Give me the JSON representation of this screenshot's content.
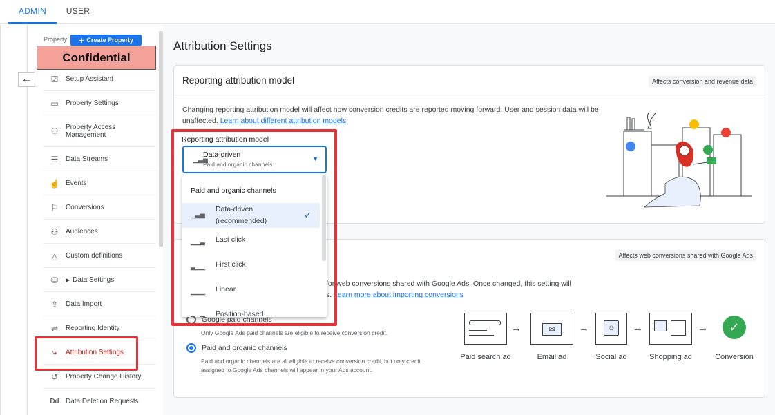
{
  "tabs": {
    "admin": "ADMIN",
    "user": "USER"
  },
  "sidebar": {
    "property_label": "Property",
    "create_button": "Create Property",
    "confidential": "Confidential",
    "items": [
      {
        "label": "Setup Assistant",
        "icon": "checkbox-icon"
      },
      {
        "label": "Property Settings",
        "icon": "window-icon"
      },
      {
        "label": "Property Access Management",
        "icon": "people-icon"
      },
      {
        "label": "Data Streams",
        "icon": "streams-icon"
      },
      {
        "label": "Events",
        "icon": "touch-icon"
      },
      {
        "label": "Conversions",
        "icon": "flag-icon"
      },
      {
        "label": "Audiences",
        "icon": "audience-icon"
      },
      {
        "label": "Custom definitions",
        "icon": "shapes-icon"
      },
      {
        "label": "Data Settings",
        "icon": "database-icon"
      },
      {
        "label": "Data Import",
        "icon": "upload-icon"
      },
      {
        "label": "Reporting Identity",
        "icon": "identity-icon"
      },
      {
        "label": "Attribution Settings",
        "icon": "attribution-icon"
      },
      {
        "label": "Property Change History",
        "icon": "history-icon"
      },
      {
        "label": "Data Deletion Requests",
        "icon": "dd-icon"
      }
    ]
  },
  "main": {
    "title": "Attribution Settings",
    "card1": {
      "title": "Reporting attribution model",
      "chip": "Affects conversion and revenue data",
      "desc": "Changing reporting attribution model will affect how conversion credits are reported moving forward. User and session data will be unaffected.",
      "link": "Learn about different attribution models",
      "field_label": "Reporting attribution model",
      "selected_value": "Data-driven",
      "selected_sub": "Paid and organic channels"
    },
    "dropdown": {
      "header": "Paid and organic channels",
      "items": [
        "Data-driven (recommended)",
        "Last click",
        "First click",
        "Linear",
        "Position-based"
      ]
    },
    "card2": {
      "chip": "Affects web conversions shared with Google Ads",
      "desc_visible": "for web conversions shared with Google Ads. Once changed, this setting will",
      "desc_suffix": "s.",
      "link": "Learn more about importing conversions",
      "radio1_label": "Google paid channels",
      "radio1_sub": "Only Google Ads paid channels are eligible to receive conversion credit.",
      "radio2_label": "Paid and organic channels",
      "radio2_sub": "Paid and organic channels are all eligible to receive conversion credit, but only credit assigned to Google Ads channels will appear in your Ads account.",
      "flow": [
        "Paid search ad",
        "Email ad",
        "Social ad",
        "Shopping ad",
        "Conversion"
      ]
    }
  }
}
